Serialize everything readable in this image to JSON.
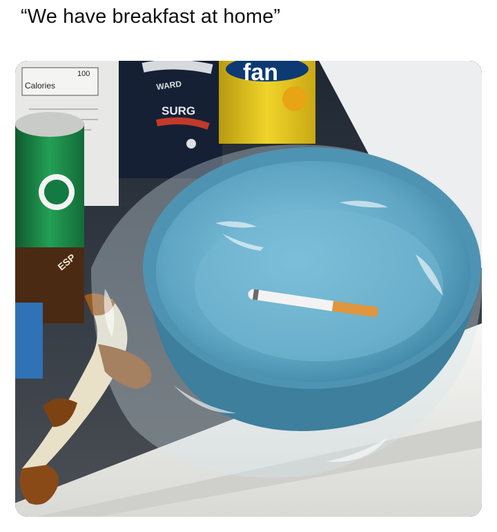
{
  "post": {
    "caption": "“We have breakfast at home”"
  },
  "photo": {
    "label_calories": "Calories",
    "label_100": "100",
    "label_ward": "WARD",
    "label_surge": "SURG",
    "label_fanta": "fan",
    "label_espresso": "ESP",
    "colors": {
      "bowl": "#5fa6c4",
      "bowl_inner": "#7cc0db",
      "fanta_can": "#e3c21a",
      "starbucks_can": "#1f8a4a",
      "shelf": "#ececea"
    }
  }
}
